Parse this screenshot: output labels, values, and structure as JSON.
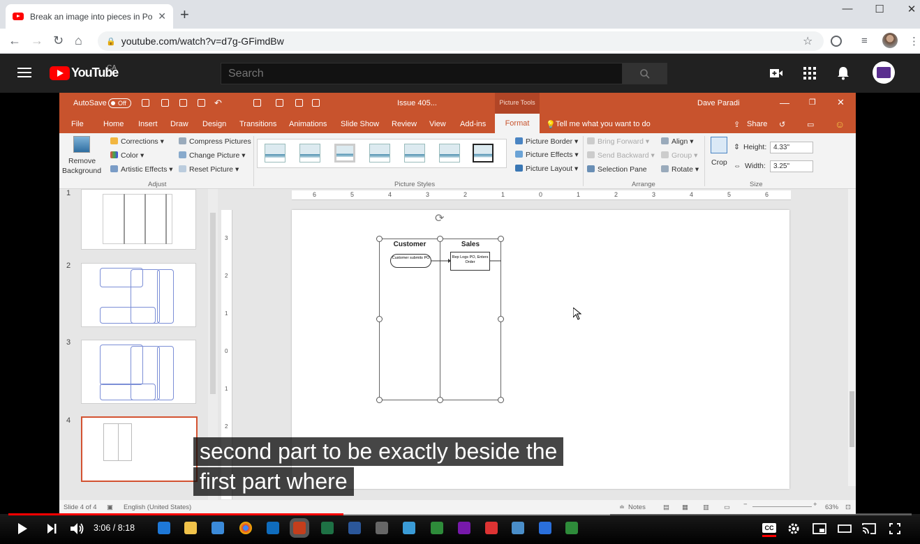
{
  "browser": {
    "tab_title": "Break an image into pieces in Po",
    "tab_close": "✕",
    "new_tab": "+",
    "url": "youtube.com/watch?v=d7g-GFimdBw",
    "minimize": "—",
    "maximize": "☐",
    "close": "✕"
  },
  "youtube": {
    "logo_word": "YouTube",
    "region": "CA",
    "search_placeholder": "Search"
  },
  "ppt": {
    "autosave": "AutoSave",
    "autosave_state": "Off",
    "doc_title": "Issue 405...",
    "picture_tools": "Picture Tools",
    "user": "Dave Paradi",
    "tabs": [
      "File",
      "Home",
      "Insert",
      "Draw",
      "Design",
      "Transitions",
      "Animations",
      "Slide Show",
      "Review",
      "View",
      "Add-ins"
    ],
    "active_tab": "Format",
    "tell_me": "Tell me what you want to do",
    "share": "Share",
    "ribbon": {
      "remove_bg_1": "Remove",
      "remove_bg_2": "Background",
      "corrections": "Corrections",
      "color": "Color",
      "artistic": "Artistic Effects",
      "compress": "Compress Pictures",
      "change": "Change Picture",
      "reset": "Reset Picture",
      "group_adjust": "Adjust",
      "group_styles": "Picture Styles",
      "border": "Picture Border",
      "effects": "Picture Effects",
      "layout": "Picture Layout",
      "bring_forward": "Bring Forward",
      "send_backward": "Send Backward",
      "selection_pane": "Selection Pane",
      "align": "Align",
      "group": "Group",
      "rotate": "Rotate",
      "group_arrange": "Arrange",
      "crop": "Crop",
      "height_label": "Height:",
      "height_value": "4.33\"",
      "width_label": "Width:",
      "width_value": "3.25\"",
      "group_size": "Size"
    },
    "slide_numbers": [
      "1",
      "2",
      "3",
      "4"
    ],
    "ruler_h": [
      "6",
      "5",
      "4",
      "3",
      "2",
      "1",
      "0",
      "1",
      "2",
      "3",
      "4",
      "5",
      "6"
    ],
    "ruler_v": [
      "3",
      "2",
      "1",
      "0",
      "1",
      "2"
    ],
    "slide": {
      "lane1": "Customer",
      "lane2": "Sales",
      "box1": "Customer submits PO",
      "box2": "Rep Logs PO, Enters Order"
    },
    "status_slide": "Slide 4 of 4",
    "status_lang": "English (United States)",
    "status_notes": "Notes",
    "status_zoom": "63%"
  },
  "captions": {
    "line1": "second part to be exactly beside the",
    "line2": "first part where"
  },
  "player": {
    "time": "3:06 / 8:18",
    "cc": "CC",
    "progress_fraction": 0.371
  }
}
